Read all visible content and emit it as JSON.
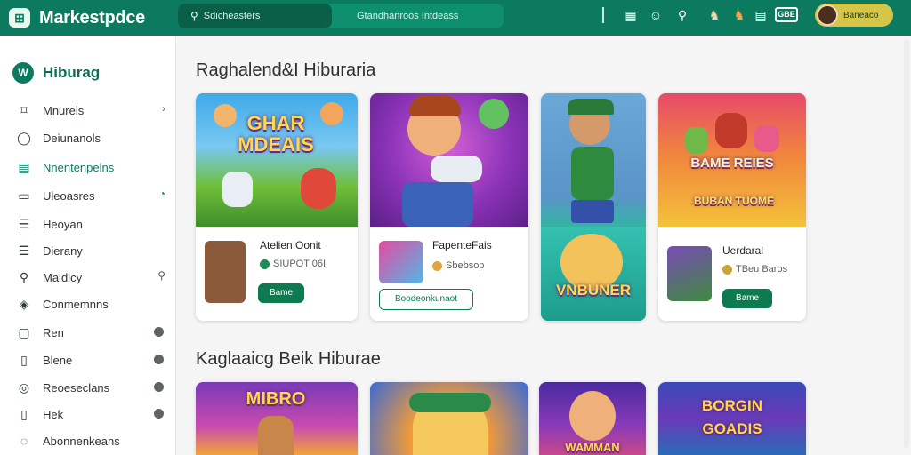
{
  "topbar": {
    "app_name": "Markestpdce",
    "logo_icon": "store-icon",
    "search_primary": "Sdicheasters",
    "search_secondary": "Gtandhanroos  Intdeass",
    "icons": [
      "grid-icon",
      "emoji-icon",
      "search-icon",
      "character-icon",
      "character-icon",
      "badge-icon"
    ],
    "badge_label": "GBE",
    "profile_name": "Baneaco"
  },
  "sidebar": {
    "brand_icon": "W",
    "brand_label": "Hiburag",
    "items": [
      {
        "label": "Mnurels",
        "icon": "bookmark-icon",
        "trail": "›"
      },
      {
        "label": "Deiunanols",
        "icon": "chat-icon",
        "trail": ""
      },
      {
        "label": "Nnentenpelns",
        "icon": "calendar-icon",
        "trail": "",
        "active": true
      },
      {
        "label": "Uleoasres",
        "icon": "card-icon",
        "trail": "◔"
      },
      {
        "label": "Heoyan",
        "icon": "list-icon",
        "trail": ""
      },
      {
        "label": "Dierany",
        "icon": "list-icon",
        "trail": ""
      },
      {
        "label": "Maidicy",
        "icon": "search-icon",
        "trail": "⚲"
      },
      {
        "label": "Conmemnns",
        "icon": "tag-icon",
        "trail": ""
      },
      {
        "label": "Ren",
        "icon": "box-icon",
        "trail": "●"
      },
      {
        "label": "Blene",
        "icon": "clipboard-icon",
        "trail": "●"
      },
      {
        "label": "Reoeseclans",
        "icon": "target-icon",
        "trail": "●"
      },
      {
        "label": "Hek",
        "icon": "document-icon",
        "trail": "●"
      },
      {
        "label": "Abonnenkeans",
        "icon": "user-icon",
        "trail": ""
      }
    ]
  },
  "sections": [
    {
      "title": "Raghalend&I Hiburaria"
    },
    {
      "title": "Kaglaaicg Beik Hiburae"
    }
  ],
  "cards_row1": [
    {
      "thumb_text": "GHAR MDEAIS",
      "title": "Atelien Oonit",
      "meta": "SIUPOT 06I",
      "button": "Bame"
    },
    {
      "title": "FapenteFais",
      "meta": "Sbebsop",
      "button": "Boodeonkunaot"
    },
    {
      "thumb_text": "VNBUNER"
    },
    {
      "thumb_text": "BAME REIES",
      "thumb_sub": "BUBAN  TUOME",
      "title": "Uerdaral",
      "meta": "TBeu Baros",
      "button": "Bame"
    }
  ],
  "cards_row2": [
    {
      "thumb_text": "MIBRO"
    },
    {
      "thumb_text": ""
    },
    {
      "thumb_text": "WAMMAN"
    },
    {
      "thumb_text": "BORGIN GOADIS"
    }
  ],
  "colors": {
    "accent": "#0b7a5e",
    "button": "#0d7a4f",
    "profile": "#d6c648"
  }
}
